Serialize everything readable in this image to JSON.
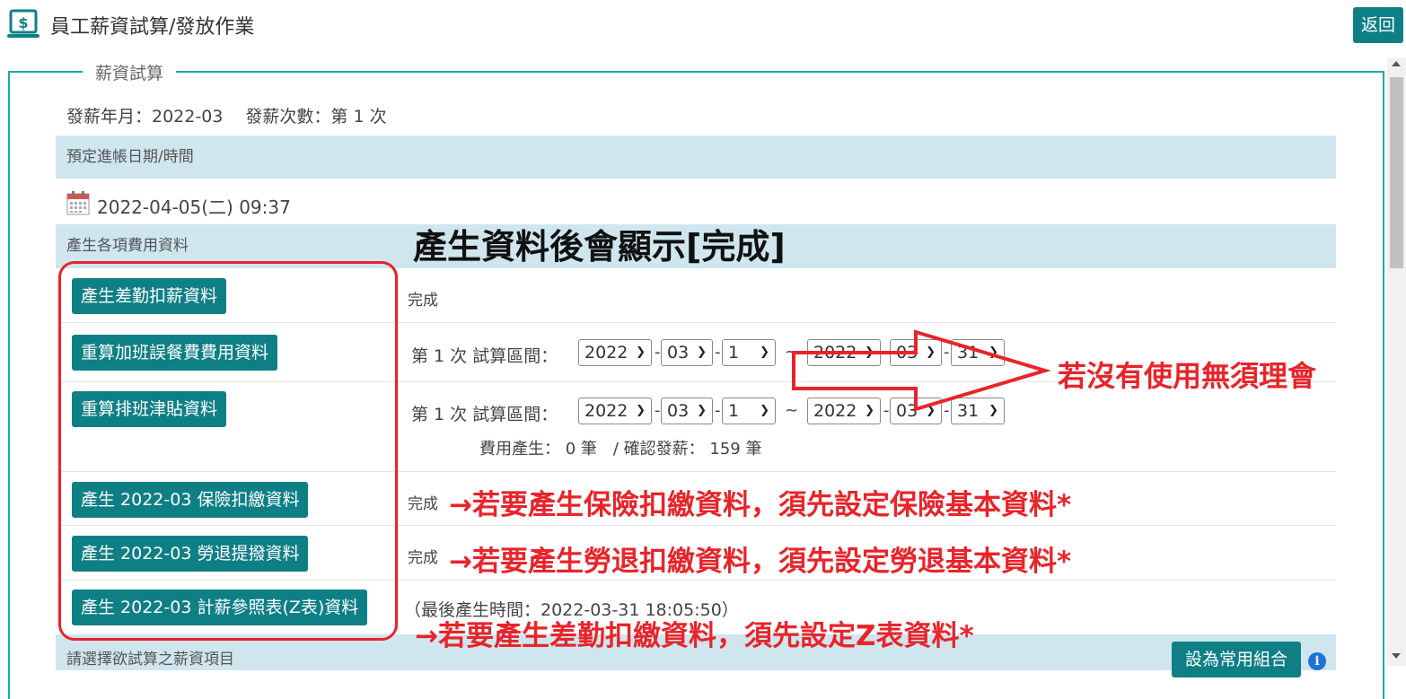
{
  "header": {
    "title": "員工薪資試算/發放作業",
    "back_label": "返回"
  },
  "section": {
    "legend": "薪資試算"
  },
  "info": {
    "text": "發薪年月：2022-03　 發薪次數：第 1 次"
  },
  "bands": {
    "posting": "預定進帳日期/時間",
    "generate": "產生各項費用資料",
    "choose": "請選擇欲試算之薪資項目"
  },
  "posting_datetime": "2022-04-05(二) 09:37",
  "rows": {
    "attendance": {
      "button": "產生差勤扣薪資料",
      "status": "完成"
    },
    "overtime": {
      "button": "重算加班誤餐費費用資料",
      "label": "第 1 次 試算區間：",
      "from": {
        "year": "2022",
        "month": "03",
        "day": "1"
      },
      "to": {
        "year": "2022",
        "month": "03",
        "day": "31"
      },
      "tilde": "~"
    },
    "shift": {
      "button": "重算排班津貼資料",
      "label": "第 1 次 試算區間：",
      "from": {
        "year": "2022",
        "month": "03",
        "day": "1"
      },
      "to": {
        "year": "2022",
        "month": "03",
        "day": "31"
      },
      "tilde": "~",
      "summary": "費用產生： 0 筆　/ 確認發薪： 159 筆"
    },
    "insurance": {
      "button": "產生 2022-03 保險扣繳資料",
      "status": "完成"
    },
    "pension": {
      "button": "產生 2022-03 勞退提撥資料",
      "status": "完成"
    },
    "ztable": {
      "button": "產生 2022-03 計薪參照表(Z表)資料",
      "status": "（最後產生時間：2022-03-31 18:05:50）"
    }
  },
  "common_combo_label": "設為常用組合",
  "annotations": {
    "heading": "產生資料後會顯示[完成]",
    "arrow_note": "若沒有使用無須理會",
    "insurance_note": "→若要產生保險扣繳資料，須先設定保險基本資料*",
    "pension_note": "→若要產生勞退扣繳資料，須先設定勞退基本資料*",
    "ztable_note": "→若要產生差勤扣繳資料，須先設定Z表資料*"
  },
  "colors": {
    "teal": "#0f7f86",
    "band": "#cfe6ef",
    "annotation_red": "#e8242a",
    "frame": "#1aa8ad"
  },
  "icons": [
    "money-icon",
    "calendar-icon",
    "info-icon",
    "chevron-down-icon"
  ]
}
